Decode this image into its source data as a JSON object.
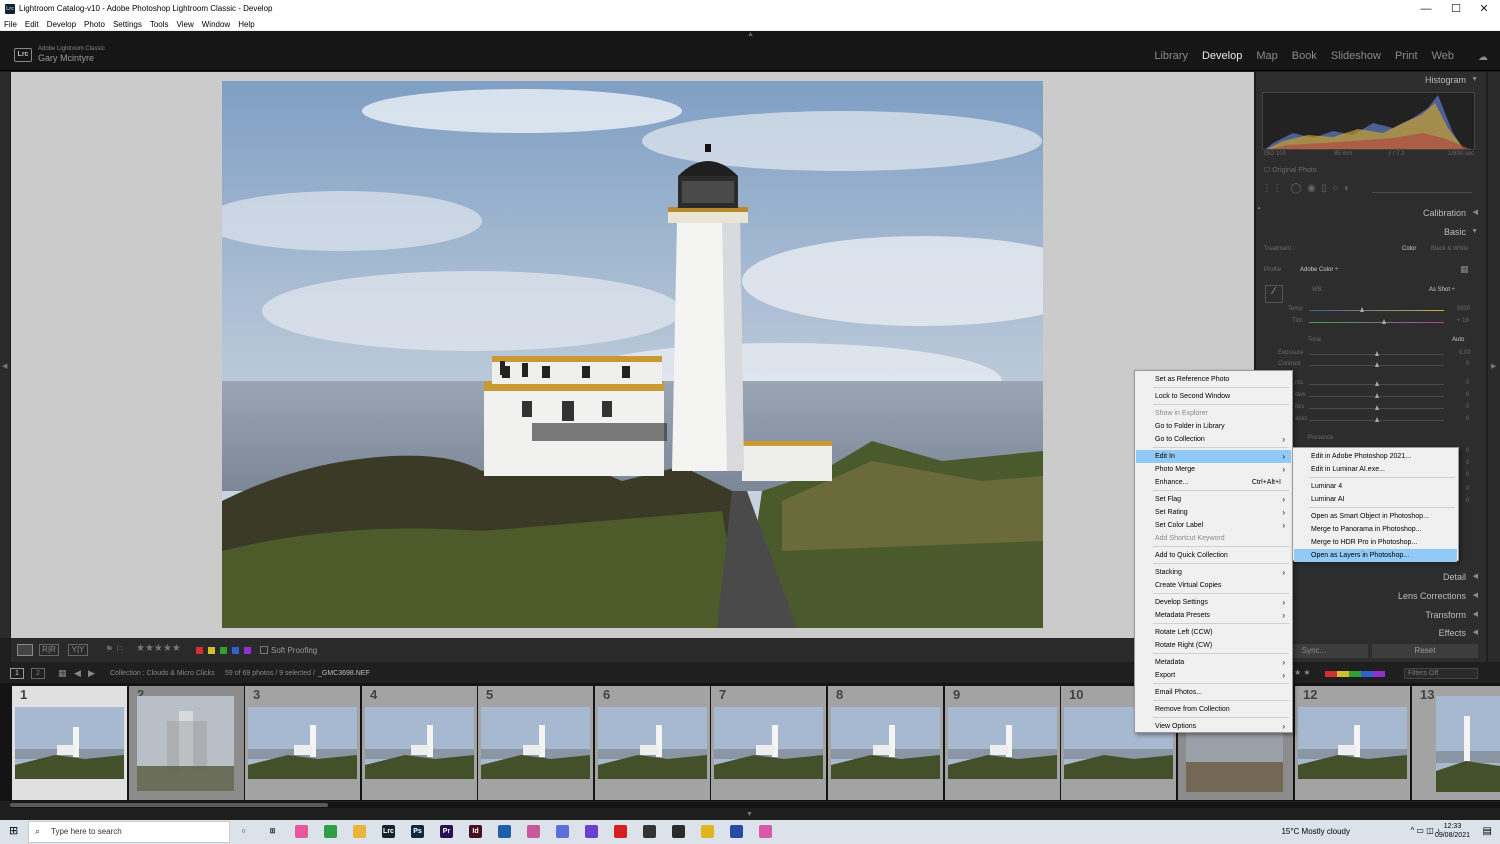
{
  "window": {
    "title": "Lightroom Catalog-v10 - Adobe Photoshop Lightroom Classic - Develop",
    "app_icon": "Lrc"
  },
  "menubar": [
    "File",
    "Edit",
    "Develop",
    "Photo",
    "Settings",
    "Tools",
    "View",
    "Window",
    "Help"
  ],
  "identity": {
    "product": "Adobe Lightroom Classic",
    "user": "Gary Mcintyre",
    "logo": "Lrc"
  },
  "modules": [
    "Library",
    "Develop",
    "Map",
    "Book",
    "Slideshow",
    "Print",
    "Web"
  ],
  "active_module": "Develop",
  "histogram": {
    "title": "Histogram",
    "iso": "ISO 100",
    "focal": "85 mm",
    "aperture": "ƒ / 7.1",
    "shutter": "1/800 sec",
    "original_photo": "Original Photo"
  },
  "panels": {
    "calibration": "Calibration",
    "basic": "Basic",
    "treatment_label": "Treatment :",
    "treatment_color": "Color",
    "treatment_bw": "Black & White",
    "profile_label": "Profile",
    "profile_value": "Adobe Color ÷",
    "wb_label": "WB :",
    "wb_value": "As Shot ÷",
    "temp_label": "Temp",
    "temp_value": "5900",
    "tint_label": "Tint",
    "tint_value": "+ 18",
    "tone_label": "Tone",
    "tone_auto": "Auto",
    "exposure_label": "Exposure",
    "exposure_value": "0.00",
    "contrast_label": "Contrast",
    "contrast_value": "0",
    "partial_labels": [
      "nts",
      "ows",
      "ites",
      "acks"
    ],
    "zero": "0",
    "presence_label": "Presence",
    "detail": "Detail",
    "lens": "Lens Corrections",
    "transform": "Transform",
    "effects": "Effects",
    "sync": "Sync...",
    "reset": "Reset"
  },
  "toolbar": {
    "soft_proofing": "Soft Proofing",
    "stars": "★★★★★"
  },
  "filmstrip_bar": {
    "collection": "Collection : Clouds & Micro Clicks",
    "count": "59 of 69 photos / 9 selected /",
    "filename": "_GMC3698.NEF",
    "filters": "Filters Off",
    "pages": [
      "1",
      "2"
    ]
  },
  "filmstrip": {
    "cells": [
      "1",
      "2",
      "3",
      "4",
      "5",
      "6",
      "7",
      "8",
      "9",
      "10",
      "11",
      "12",
      "13"
    ]
  },
  "context_menu": {
    "items": [
      {
        "label": "Set as Reference Photo"
      },
      {
        "sep": true
      },
      {
        "label": "Lock to Second Window"
      },
      {
        "sep": true
      },
      {
        "label": "Show in Explorer",
        "disabled": true
      },
      {
        "label": "Go to Folder in Library"
      },
      {
        "label": "Go to Collection",
        "arrow": true
      },
      {
        "sep": true
      },
      {
        "label": "Edit In",
        "arrow": true,
        "highlight": true
      },
      {
        "label": "Photo Merge",
        "arrow": true
      },
      {
        "label": "Enhance...",
        "shortcut": "Ctrl+Alt+I"
      },
      {
        "sep": true
      },
      {
        "label": "Set Flag",
        "arrow": true
      },
      {
        "label": "Set Rating",
        "arrow": true
      },
      {
        "label": "Set Color Label",
        "arrow": true
      },
      {
        "label": "Add Shortcut Keyword",
        "disabled": true
      },
      {
        "sep": true
      },
      {
        "label": "Add to Quick Collection"
      },
      {
        "sep": true
      },
      {
        "label": "Stacking",
        "arrow": true
      },
      {
        "label": "Create Virtual Copies"
      },
      {
        "sep": true
      },
      {
        "label": "Develop Settings",
        "arrow": true
      },
      {
        "label": "Metadata Presets",
        "arrow": true
      },
      {
        "sep": true
      },
      {
        "label": "Rotate Left (CCW)"
      },
      {
        "label": "Rotate Right (CW)"
      },
      {
        "sep": true
      },
      {
        "label": "Metadata",
        "arrow": true
      },
      {
        "label": "Export",
        "arrow": true
      },
      {
        "sep": true
      },
      {
        "label": "Email Photos..."
      },
      {
        "sep": true
      },
      {
        "label": "Remove from Collection"
      },
      {
        "sep": true
      },
      {
        "label": "View Options",
        "arrow": true
      }
    ]
  },
  "submenu": {
    "items": [
      {
        "label": "Edit in Adobe Photoshop 2021..."
      },
      {
        "label": "Edit in Luminar AI.exe..."
      },
      {
        "sep": true
      },
      {
        "label": "Luminar 4"
      },
      {
        "label": "Luminar AI"
      },
      {
        "sep": true
      },
      {
        "label": "Open as Smart Object in Photoshop..."
      },
      {
        "label": "Merge to Panorama in Photoshop..."
      },
      {
        "label": "Merge to HDR Pro in Photoshop..."
      },
      {
        "label": "Open as Layers in Photoshop...",
        "highlight": true
      }
    ]
  },
  "taskbar": {
    "search_placeholder": "Type here to search",
    "weather": "15°C  Mostly cloudy",
    "time": "12:33",
    "date": "09/08/2021",
    "apps": [
      {
        "name": "task-view-icon",
        "label": "○",
        "color": "#dbe2ea"
      },
      {
        "name": "widgets-icon",
        "label": "⊞",
        "color": "#dbe2ea"
      },
      {
        "name": "photos-app-icon",
        "label": "",
        "color": "#e8579b"
      },
      {
        "name": "chrome-icon",
        "label": "",
        "color": "#2f9e44"
      },
      {
        "name": "file-explorer-icon",
        "label": "",
        "color": "#e8b43a"
      },
      {
        "name": "lightroom-icon",
        "label": "Lrc",
        "color": "#15232e"
      },
      {
        "name": "photoshop-icon",
        "label": "Ps",
        "color": "#0f2841"
      },
      {
        "name": "premiere-icon",
        "label": "Pr",
        "color": "#2a1250"
      },
      {
        "name": "indesign-icon",
        "label": "Id",
        "color": "#4a0f1c"
      },
      {
        "name": "app-cube-icon",
        "label": "",
        "color": "#1d5fa8"
      },
      {
        "name": "app-brain-icon",
        "label": "",
        "color": "#c85a9a"
      },
      {
        "name": "app-gear-icon",
        "label": "",
        "color": "#5a6fd8"
      },
      {
        "name": "app-circle-icon",
        "label": "",
        "color": "#6b3fd0"
      },
      {
        "name": "acrobat-icon",
        "label": "",
        "color": "#d81f1f"
      },
      {
        "name": "app-aperture-icon",
        "label": "",
        "color": "#333333"
      },
      {
        "name": "app-frame-icon",
        "label": "",
        "color": "#2a2a2a"
      },
      {
        "name": "app-smile-icon",
        "label": "",
        "color": "#e0b520"
      },
      {
        "name": "affinity-icon",
        "label": "",
        "color": "#2a4aa8"
      },
      {
        "name": "messenger-icon",
        "label": "",
        "color": "#d85aa8"
      }
    ]
  }
}
